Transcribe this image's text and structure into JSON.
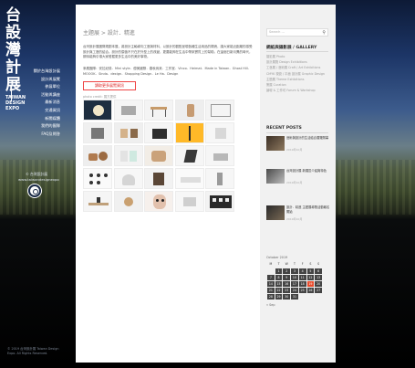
{
  "brand": {
    "logo_line1": "台設",
    "logo_line2": "灣計",
    "logo_line3": "展",
    "logo_small": "TAIWAN DESIGN EXPO"
  },
  "left_nav": {
    "items": [
      "關於台灣設計展",
      "設計與展覽",
      "參展單位",
      "活動與講座",
      "最新消息",
      "交通資訊",
      "新聞媒體",
      "我們的團隊",
      "FAQ及問答"
    ],
    "footer_line1": "© 台灣設計展",
    "footer_line2": "www.taiwandesignexpo"
  },
  "left_copy": "© 2019 台灣設計展 Taiwan Design Expo. All Rights Reserved.",
  "main": {
    "breadcrumb": "主題展 > 設計．精進",
    "intro": "台灣設計展團隊規劃本展，將設計主軸導向工藝與材料，以設計的觀點呈現各種生活用品的樣貌，讓大家能近距離的感受設計與工藝的結合。設計的價值不只在於外型上的改變，更要能夠在生活中帶來實質上的幫助。在這個日新月異的時代，期待能夠引領大家發掘更多生活中的美好事物。",
    "tags": "參展團隊：安拉紀錄．Mini style．優美國際．春秋烏來．工作室．Vinco．Heimat．Made in Taiwan．Ghost Hill．MOOOK．Sinda．dexign．Shopping Design．Le Ha．Design",
    "more_button": "讀取更多展覽資訊",
    "caption": "photo credit: 展方提供"
  },
  "sidebar": {
    "search_placeholder": "Search ...",
    "search_icon": "search-icon",
    "gallery_title": "網紙與攝影展 / GALLERY",
    "gallery_items": [
      "攝影展 Photo",
      "設計展覽 Design Exhibitions",
      "工藝展 / 藝術展 Craft / Art Exhibitions",
      "CMYK 視覺 / 平面 設計展 Graphic Design",
      "主題展 Theme Exhibitions",
      "策展 Curation",
      "論壇 & 工作坊 Forum & Workshop"
    ],
    "recent_title": "RECENT POSTS",
    "posts": [
      {
        "title": "藝術與設計的生活結合展覽開幕",
        "date": "2019年10月"
      },
      {
        "title": "台灣設計展 新展區介紹與特色",
        "date": "2019年10月"
      },
      {
        "title": "設計．精進 主題展導覽活動報名開始",
        "date": "2019年10月"
      }
    ],
    "calendar": {
      "month": "October 2019",
      "weekdays": [
        "M",
        "T",
        "W",
        "T",
        "F",
        "S",
        "S"
      ],
      "weeks": [
        [
          "",
          "1",
          "2",
          "3",
          "4",
          "5",
          "6"
        ],
        [
          "7",
          "8",
          "9",
          "10",
          "11",
          "12",
          "13"
        ],
        [
          "14",
          "15",
          "16",
          "17",
          "18",
          "19",
          "20"
        ],
        [
          "21",
          "22",
          "23",
          "24",
          "25",
          "26",
          "27"
        ],
        [
          "28",
          "29",
          "30",
          "31",
          "",
          "",
          ""
        ]
      ],
      "prev_link": "« Sep"
    }
  },
  "colors": {
    "accent_red": "#e84a2b",
    "button_border": "#ee4444"
  }
}
